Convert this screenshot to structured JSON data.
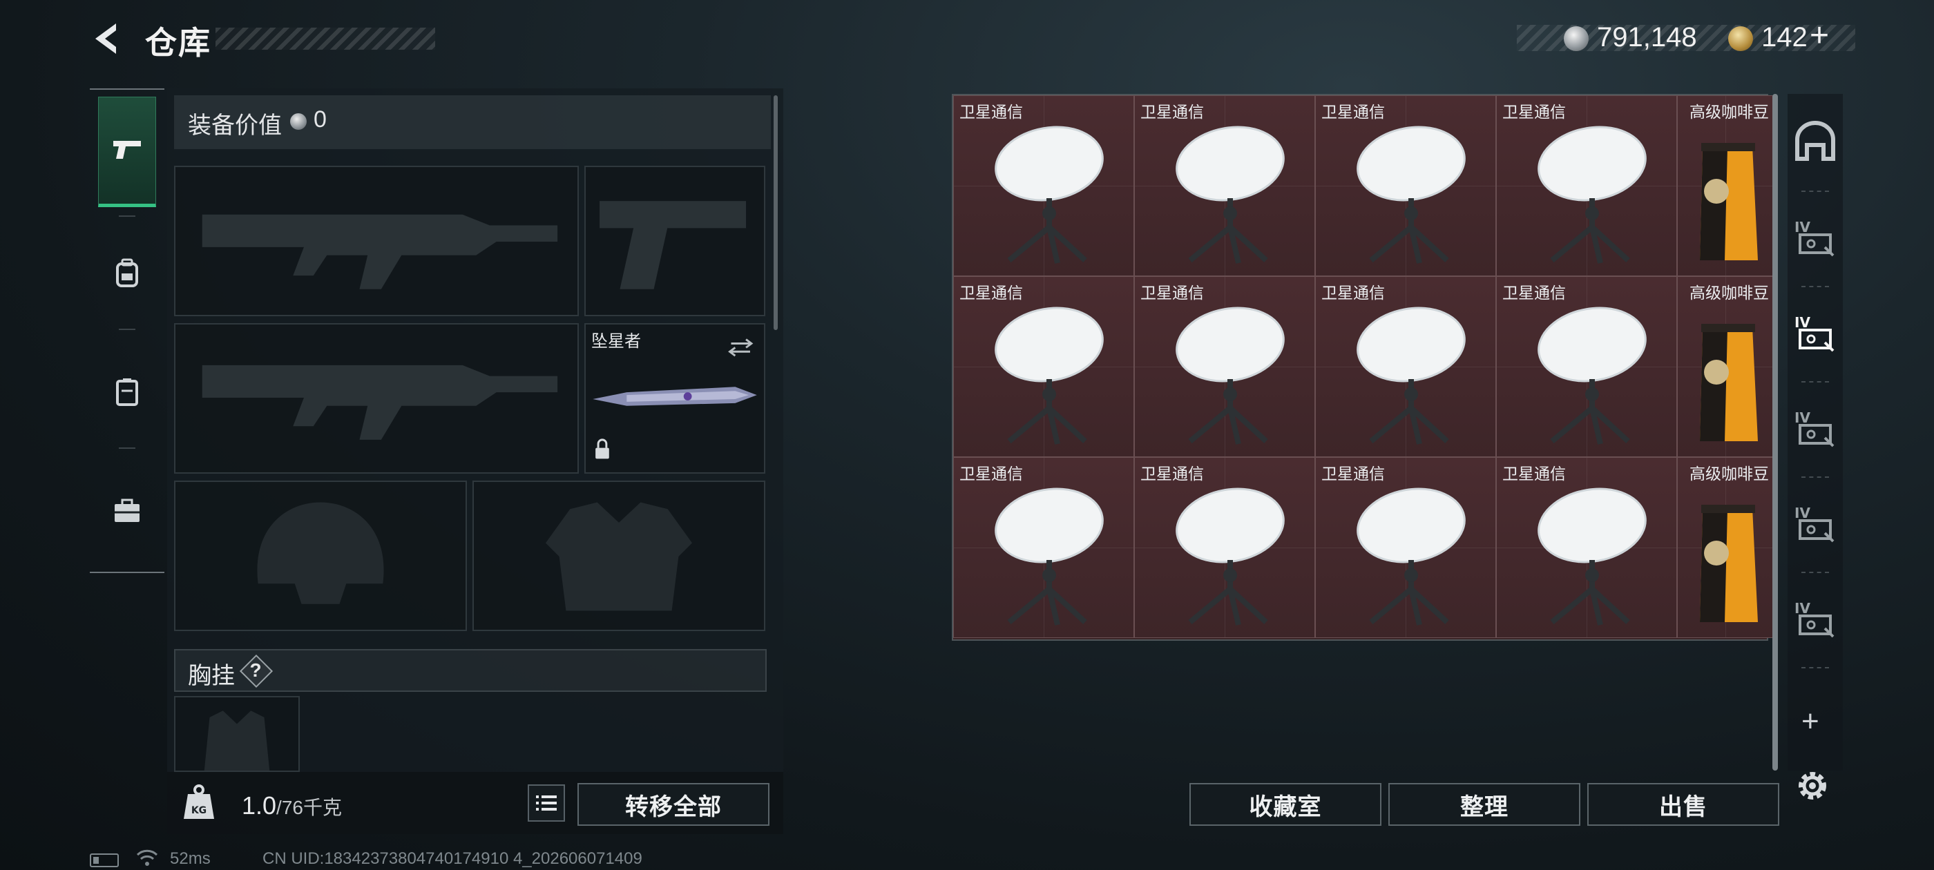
{
  "header": {
    "title": "仓库",
    "currency_silver": "791,148",
    "currency_gold": "142",
    "gold_plus": "+"
  },
  "equipment": {
    "value_label": "装备价值",
    "value_amount": "0",
    "melee_name": "坠星者",
    "chest_label": "胸挂",
    "help_mark": "?",
    "weight_current": "1.0",
    "weight_max": "/76千克",
    "transfer_all": "转移全部"
  },
  "stash": {
    "rows": [
      [
        "卫星通信",
        "卫星通信",
        "卫星通信",
        "卫星通信",
        "高级咖啡豆"
      ],
      [
        "卫星通信",
        "卫星通信",
        "卫星通信",
        "卫星通信",
        "高级咖啡豆"
      ],
      [
        "卫星通信",
        "卫星通信",
        "卫星通信",
        "卫星通信",
        "高级咖啡豆"
      ]
    ]
  },
  "actions": {
    "collection": "收藏室",
    "sort": "整理",
    "sell": "出售"
  },
  "side_icons": [
    "home-icon",
    "stash-tier-iv-icon",
    "stash-tier-iv-icon",
    "stash-tier-iv-icon",
    "stash-tier-iv-icon",
    "stash-tier-iv-icon",
    "add-icon",
    "gear-icon"
  ],
  "status": {
    "ping": "52ms",
    "uid": "CN UID:18342373804740174910 4_202606071409"
  },
  "colors": {
    "accent_green": "#35c184",
    "stash_bg": "#3a2426"
  }
}
